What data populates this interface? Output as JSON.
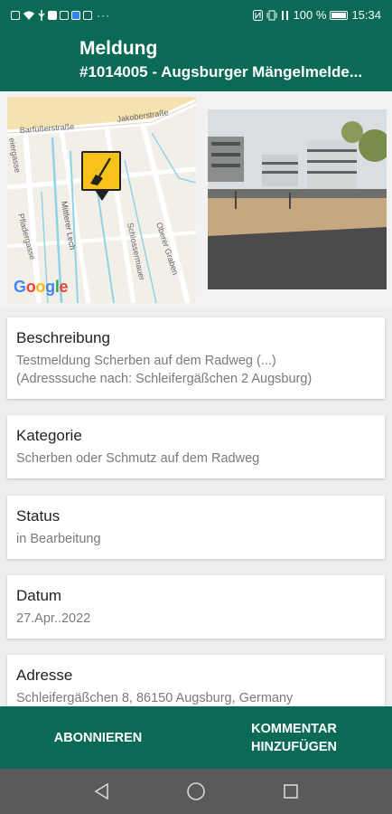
{
  "status_bar": {
    "battery_text": "100 %",
    "time": "15:34"
  },
  "app_bar": {
    "title": "Meldung",
    "subtitle": "#1014005 - Augsburger Mängelmelde..."
  },
  "map": {
    "streets": [
      "Barfüßerstraße",
      "Jakoberstraße",
      "Mittlerer Lech",
      "Schlossermauer",
      "Oberer Graben",
      "Pfladergasse",
      "eiergasse"
    ],
    "logo": "Google",
    "marker_icon": "broom-icon"
  },
  "cards": [
    {
      "title": "Beschreibung",
      "text": "Testmeldung Scherben auf dem Radweg (...)\n(Adresssuche nach: Schleifergäßchen 2 Augsburg)"
    },
    {
      "title": "Kategorie",
      "text": "Scherben oder Schmutz auf dem Radweg"
    },
    {
      "title": "Status",
      "text": "in Bearbeitung"
    },
    {
      "title": "Datum",
      "text": "27.Apr..2022"
    },
    {
      "title": "Adresse",
      "text": "Schleifergäßchen 8, 86150 Augsburg, Germany"
    }
  ],
  "bottom_bar": {
    "subscribe_label": "ABONNIEREN",
    "comment_label_line1": "KOMMENTAR",
    "comment_label_line2": "HINZUFÜGEN"
  },
  "colors": {
    "primary": "#0b6a56",
    "marker": "#f7c21a"
  }
}
